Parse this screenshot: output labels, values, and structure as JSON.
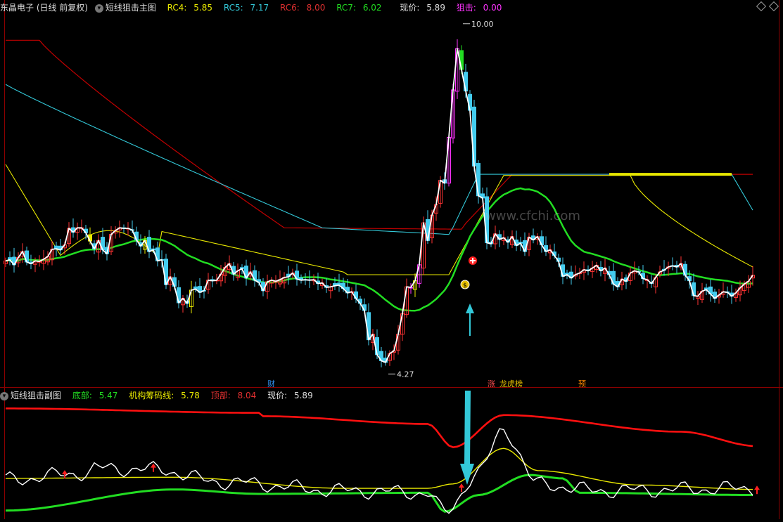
{
  "main_header": {
    "title": "东晶电子 (日线 前复权)",
    "indicator": "短线狙击主图",
    "rc4_label": "RC4:",
    "rc4_value": "5.85",
    "rc5_label": "RC5:",
    "rc5_value": "7.17",
    "rc6_label": "RC6:",
    "rc6_value": "8.00",
    "rc7_label": "RC7:",
    "rc7_value": "6.02",
    "price_label": "现价:",
    "price_value": "5.89",
    "snipe_label": "狙击:",
    "snipe_value": "0.00"
  },
  "sub_header": {
    "indicator": "短线狙击副图",
    "bottom_label": "底部:",
    "bottom_value": "5.47",
    "inst_label": "机构筹码线:",
    "inst_value": "5.78",
    "top_label": "顶部:",
    "top_value": "8.04",
    "price_label": "现价:",
    "price_value": "5.89"
  },
  "annotations": {
    "high_label": "10.00",
    "low_label": "4.27",
    "tag_cai": "财",
    "tag_zhang": "涨",
    "tag_longhu": "龙虎榜",
    "tag_yu": "预",
    "dollar_icon": "$"
  },
  "watermark": "www.cfchi.com",
  "colors": {
    "red_line": "#c00000",
    "cyan_line": "#33c8d8",
    "yellow_line": "#e8e800",
    "green_line": "#22dd22",
    "white_line": "#ffffff",
    "up_candle": "#ff3333",
    "down_candle": "#44ccee",
    "magenta": "#ff33ff",
    "top_red": "#ff1010"
  },
  "chart_data": [
    {
      "type": "candlestick",
      "panel": "main",
      "ylim": [
        3.9,
        10.6
      ],
      "x": [
        0,
        1,
        2,
        3,
        4,
        5,
        6,
        7,
        8,
        9,
        10,
        11,
        12,
        13,
        14,
        15,
        16,
        17,
        18,
        19,
        20,
        21,
        22,
        23,
        24,
        25,
        26,
        27,
        28,
        29,
        30,
        31,
        32,
        33,
        34,
        35,
        36,
        37,
        38,
        39,
        40,
        41,
        42,
        43,
        44,
        45,
        46,
        47,
        48,
        49,
        50,
        51,
        52,
        53,
        54,
        55,
        56,
        57,
        58,
        59,
        60,
        61,
        62,
        63,
        64,
        65,
        66,
        67,
        68,
        69,
        70,
        71,
        72,
        73,
        74,
        75,
        76,
        77,
        78,
        79,
        80,
        81,
        82,
        83,
        84,
        85,
        86,
        87,
        88,
        89,
        90,
        91,
        92,
        93,
        94,
        95,
        96,
        97,
        98,
        99,
        100,
        101,
        102,
        103,
        104,
        105,
        106,
        107,
        108,
        109,
        110,
        111,
        112,
        113,
        114,
        115,
        116,
        117,
        118,
        119,
        120,
        121,
        122,
        123,
        124,
        125,
        126,
        127,
        128,
        129,
        130,
        131,
        132,
        133,
        134,
        135,
        136,
        137,
        138,
        139,
        140,
        141,
        142,
        143,
        144,
        145,
        146,
        147,
        148,
        149,
        150,
        151,
        152,
        153,
        154,
        155,
        156,
        157,
        158,
        159,
        160,
        161,
        162,
        163,
        164,
        165,
        166,
        167,
        168,
        169,
        170,
        171,
        172,
        173,
        174,
        175,
        176,
        177,
        178
      ],
      "close": [
        6.15,
        6.17,
        6.08,
        6.21,
        6.32,
        6.13,
        6.1,
        6.15,
        6.14,
        6.18,
        6.23,
        6.36,
        6.37,
        6.35,
        6.44,
        6.74,
        6.67,
        6.75,
        6.75,
        6.66,
        6.51,
        6.37,
        6.52,
        6.35,
        6.28,
        6.63,
        6.7,
        6.75,
        6.74,
        6.74,
        6.71,
        6.53,
        6.42,
        6.52,
        6.32,
        6.35,
        6.15,
        6.17,
        5.72,
        5.86,
        5.69,
        5.39,
        5.47,
        5.38,
        5.62,
        5.64,
        5.58,
        5.61,
        5.8,
        5.79,
        5.8,
        5.91,
        6.03,
        6.1,
        5.91,
        5.97,
        6.01,
        5.84,
        5.95,
        5.8,
        5.76,
        5.61,
        5.77,
        5.8,
        5.78,
        5.81,
        5.85,
        5.86,
        5.93,
        5.82,
        5.8,
        5.81,
        5.8,
        5.81,
        5.74,
        5.75,
        5.67,
        5.68,
        5.7,
        5.71,
        5.65,
        5.57,
        5.59,
        5.47,
        5.38,
        5.25,
        4.72,
        4.82,
        4.45,
        4.34,
        4.31,
        4.47,
        4.52,
        4.82,
        5.19,
        5.68,
        5.67,
        5.79,
        6.08,
        6.84,
        6.52,
        6.98,
        7.17,
        7.61,
        7.56,
        8.39,
        9.25,
        10.0,
        9.62,
        9.23,
        8.88,
        7.87,
        7.33,
        7.29,
        6.48,
        6.46,
        6.64,
        6.54,
        6.57,
        6.49,
        6.59,
        6.43,
        6.47,
        6.32,
        6.58,
        6.53,
        6.59,
        6.44,
        6.32,
        6.35,
        6.25,
        6.14,
        5.87,
        5.9,
        5.84,
        5.9,
        5.93,
        5.99,
        5.97,
        6.02,
        6.07,
        5.97,
        6.02,
        5.9,
        5.73,
        5.68,
        5.82,
        5.78,
        5.93,
        5.97,
        5.95,
        5.83,
        5.81,
        5.74,
        5.85,
        5.95,
        5.98,
        6.04,
        6.06,
        6.04,
        6.1,
        5.89,
        5.79,
        5.52,
        5.51,
        5.6,
        5.63,
        5.55,
        5.47,
        5.53,
        5.59,
        5.58,
        5.51,
        5.57,
        5.66,
        5.73,
        5.78,
        5.89
      ]
    },
    {
      "type": "line",
      "panel": "sub",
      "ylim": [
        0,
        100
      ],
      "series": [
        {
          "color": "#ff1010",
          "points": [
            [
              0,
              96
            ],
            [
              60,
              92
            ],
            [
              61,
              89
            ],
            [
              100,
              82
            ],
            [
              106,
              61
            ],
            [
              118,
              90
            ],
            [
              160,
              75
            ],
            [
              178,
              62
            ]
          ]
        },
        {
          "color": "#e8e800",
          "points": [
            [
              0,
              33
            ],
            [
              40,
              34
            ],
            [
              80,
              24
            ],
            [
              100,
              24
            ],
            [
              106,
              28
            ],
            [
              118,
              60
            ],
            [
              126,
              40
            ],
            [
              150,
              27
            ],
            [
              178,
              23
            ]
          ]
        },
        {
          "color": "#22dd22",
          "points": [
            [
              0,
              4
            ],
            [
              40,
              23
            ],
            [
              60,
              19
            ],
            [
              100,
              20
            ],
            [
              104,
              3
            ],
            [
              112,
              18
            ],
            [
              124,
              36
            ],
            [
              132,
              33
            ],
            [
              136,
              20
            ],
            [
              178,
              18
            ]
          ]
        },
        {
          "color": "#ffffff",
          "points": [
            [
              0,
              32
            ],
            [
              20,
              38
            ],
            [
              21,
              42
            ],
            [
              36,
              41
            ],
            [
              50,
              30
            ],
            [
              80,
              22
            ],
            [
              100,
              20
            ],
            [
              104,
              2
            ],
            [
              112,
              38
            ],
            [
              118,
              77
            ],
            [
              126,
              28
            ],
            [
              140,
              22
            ],
            [
              178,
              24
            ]
          ]
        }
      ]
    }
  ]
}
